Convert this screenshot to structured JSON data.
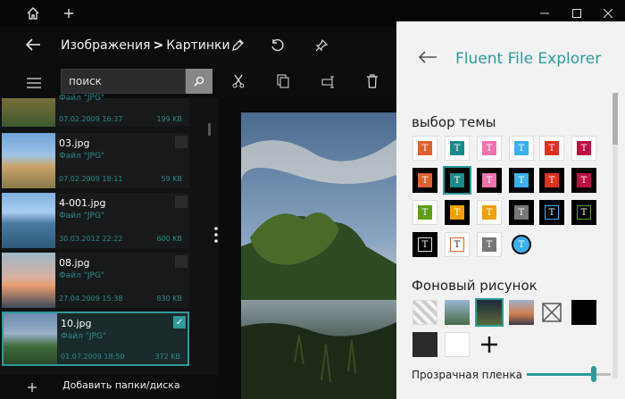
{
  "nav": {
    "crumb_root": "Изображения",
    "crumb_sep": ">",
    "crumb_leaf": "Картинки"
  },
  "search": {
    "placeholder": "поиск"
  },
  "files": [
    {
      "name": "",
      "type": "Файл \"JPG\"",
      "date": "07.02.2009 16:37",
      "size": "199 KB"
    },
    {
      "name": "03.jpg",
      "type": "Файл \"JPG\"",
      "date": "07.02.2009 18:11",
      "size": "59 KB"
    },
    {
      "name": "4-001.jpg",
      "type": "Файл \"JPG\"",
      "date": "30.03.2012 22:22",
      "size": "600 KB"
    },
    {
      "name": "08.jpg",
      "type": "Файл \"JPG\"",
      "date": "27.04.2009 15:38",
      "size": "830 KB"
    },
    {
      "name": "10.jpg",
      "type": "Файл \"JPG\"",
      "date": "01.07.2009 18:50",
      "size": "372 KB"
    }
  ],
  "bottom": {
    "add_label": "Добавить папки/диска"
  },
  "panel": {
    "title": "Fluent File Explorer",
    "theme_heading": "выбор темы",
    "bg_heading": "Фоновый рисунок",
    "transparency_label": "Прозрачная пленка",
    "transparency_value": 0.8
  },
  "icons": {
    "home": "home-icon",
    "plus": "plus-icon",
    "back": "back-arrow-icon",
    "edit": "pencil-icon",
    "refresh": "refresh-icon",
    "pin": "pin-icon",
    "menu": "hamburger-icon",
    "search": "search-icon",
    "cut": "scissors-icon",
    "copy": "copy-icon",
    "rename": "rename-icon",
    "delete": "trash-icon"
  },
  "accent": "#2e9a9a"
}
